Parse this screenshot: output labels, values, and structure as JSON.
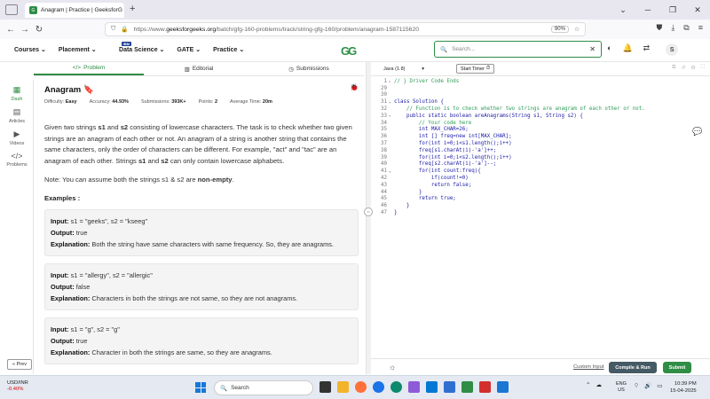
{
  "browser": {
    "tab_title": "Anagram | Practice | GeeksforG",
    "tab_close": "×",
    "new_tab": "+",
    "url_prefix": "https://www.",
    "url_host": "geeksforgeeks.org",
    "url_path": "/batch/gfg-160-problems/track/string-gfg-160/problem/anagram-1587115620",
    "zoom": "90%"
  },
  "gfg_nav": {
    "menu": [
      "Courses",
      "Placement",
      "Data Science",
      "GATE",
      "Practice"
    ],
    "new_badge": "IBM",
    "logo": "GG",
    "search_placeholder": "Search...",
    "avatar": "S"
  },
  "rail": {
    "items": [
      "Dash",
      "Articles",
      "Videos",
      "Problems"
    ],
    "prev": "« Prev"
  },
  "sub_tabs": [
    "Problem",
    "Editorial",
    "Submissions"
  ],
  "problem": {
    "title": "Anagram",
    "meta": {
      "difficulty_label": "Difficulty:",
      "difficulty": "Easy",
      "accuracy_label": "Accuracy:",
      "accuracy": "44.93%",
      "submissions_label": "Submissions:",
      "submissions": "393K+",
      "points_label": "Points:",
      "points": "2",
      "time_label": "Average Time:",
      "time": "20m"
    },
    "desc_1": "Given two strings ",
    "s1": "s1",
    "desc_2": " and ",
    "s2": "s2",
    "desc_3": " consisting of lowercase characters. The task is to check whether two given strings are an anagram of each other or not. An anagram of a string is another string that contains the same characters, only the order of characters can be different. For example, \"act\" and \"tac\" are an anagram of each other. Strings ",
    "desc_4": " can only contain lowercase alphabets.",
    "note_1": "Note: You can assume both the strings s1 & s2 are ",
    "note_2": "non-empty",
    "note_3": ".",
    "examples_heading": "Examples :",
    "input_label": "Input:",
    "output_label": "Output:",
    "explanation_label": "Explanation:",
    "examples": [
      {
        "input": "s1 = \"geeks\", s2 = \"kseeg\"",
        "output": "true",
        "explanation": "Both the string have same characters with same frequency. So, they are anagrams."
      },
      {
        "input": "s1 = \"allergy\", s2 = \"allergic\"",
        "output": "false",
        "explanation": "Characters in both the strings are not same, so they are not anagrams."
      },
      {
        "input": "s1 = \"g\", s2 = \"g\"",
        "output": "true",
        "explanation": "Character in both the strings are same, so they are anagrams."
      }
    ]
  },
  "editor": {
    "language": "Java (1.8)",
    "timer": "Start Timer",
    "lines": [
      {
        "n": "1",
        "fold": "▸",
        "text": "// } Driver Code Ends",
        "cls": "cm"
      },
      {
        "n": "29",
        "fold": "",
        "text": "",
        "cls": ""
      },
      {
        "n": "30",
        "fold": "",
        "text": "",
        "cls": ""
      },
      {
        "n": "31",
        "fold": "▾",
        "text": "class Solution {",
        "cls": ""
      },
      {
        "n": "32",
        "fold": "",
        "text": "    // Function is to check whether two strings are anagram of each other or not.",
        "cls": "cm"
      },
      {
        "n": "33",
        "fold": "▾",
        "text": "    public static boolean areAnagrams(String s1, String s2) {",
        "cls": ""
      },
      {
        "n": "34",
        "fold": "",
        "text": "        // Your code here",
        "cls": "cm"
      },
      {
        "n": "35",
        "fold": "",
        "text": "        int MAX_CHAR=26;",
        "cls": ""
      },
      {
        "n": "36",
        "fold": "",
        "text": "        int [] freq=new int[MAX_CHAR];",
        "cls": ""
      },
      {
        "n": "37",
        "fold": "",
        "text": "        for(int i=0;i<s1.length();i++)",
        "cls": ""
      },
      {
        "n": "38",
        "fold": "",
        "text": "        freq[s1.charAt(i)-'a']++;",
        "cls": ""
      },
      {
        "n": "39",
        "fold": "",
        "text": "        for(int i=0;i<s2.length();i++)",
        "cls": ""
      },
      {
        "n": "40",
        "fold": "",
        "text": "        freq[s2.charAt(i)-'a']--;",
        "cls": ""
      },
      {
        "n": "41",
        "fold": "▾",
        "text": "        for(int count:freq){",
        "cls": ""
      },
      {
        "n": "42",
        "fold": "",
        "text": "            if(count!=0)",
        "cls": ""
      },
      {
        "n": "43",
        "fold": "",
        "text": "            return false;",
        "cls": ""
      },
      {
        "n": "44",
        "fold": "",
        "text": "        }",
        "cls": ""
      },
      {
        "n": "45",
        "fold": "",
        "text": "        return true;",
        "cls": ""
      },
      {
        "n": "46",
        "fold": "",
        "text": "    }",
        "cls": ""
      },
      {
        "n": "47",
        "fold": "",
        "text": "}",
        "cls": ""
      }
    ],
    "custom_input": "Custom Input",
    "compile_run": "Compile & Run",
    "submit": "Submit"
  },
  "taskbar": {
    "ticker": "USD/INR",
    "change": "-0.40%",
    "search": "Search",
    "lang_1": "ENG",
    "lang_2": "US",
    "time": "10:39 PM",
    "date": "15-04-2025"
  },
  "colors": {
    "accent": "#2f8d46",
    "run_button": "#455a64"
  }
}
